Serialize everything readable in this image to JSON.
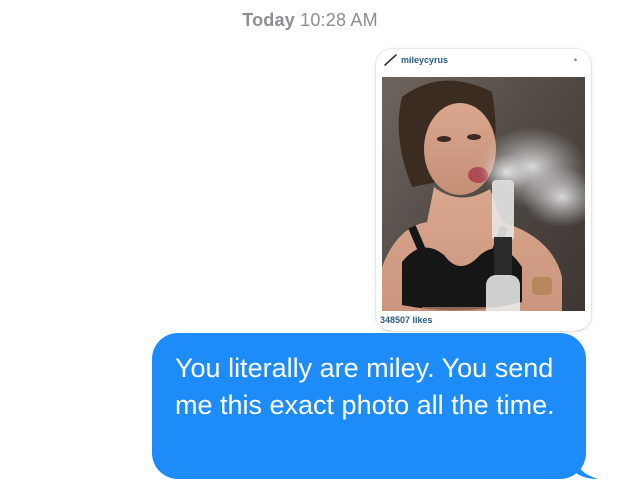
{
  "header": {
    "day": "Today",
    "time": "10:28 AM"
  },
  "attachment": {
    "username": "mileycyrus",
    "likes": "348507 likes",
    "menu_icon": "more-dots-icon",
    "photo_icon": "photo"
  },
  "message": {
    "text": "You literally are miley. You send me this exact photo all the time.",
    "sender": "outgoing"
  },
  "colors": {
    "bubble_blue": "#1e8cf8",
    "timestamp_gray": "#8e8e93",
    "ig_link_blue": "#2a5c8a"
  }
}
